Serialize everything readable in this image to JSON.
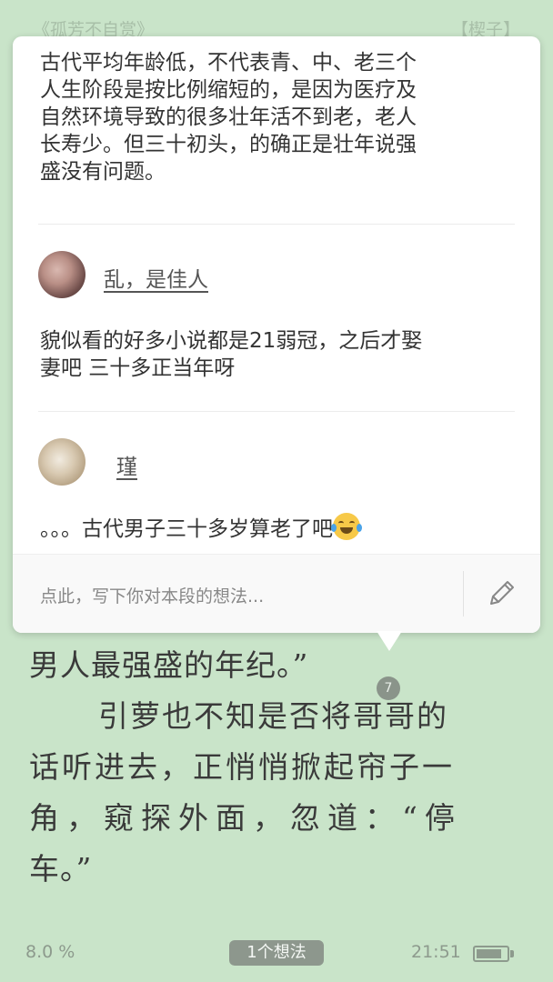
{
  "header": {
    "book_title": "《孤芳不自赏》",
    "chapter_tag": "【楔子】"
  },
  "reading": {
    "lines": [
      "男人最强盛的年纪。”",
      "引萝也不知是否将哥哥的",
      "话听进去，正悄悄掀起帘子一",
      "角，窥探外面，忽道：“停",
      "车。”"
    ],
    "idea_count_badge": "7"
  },
  "popup": {
    "comments": [
      {
        "text_lines": [
          "古代平均年龄低，不代表青、中、老三个",
          "人生阶段是按比例缩短的，是因为医疗及",
          "自然环境导致的很多壮年活不到老，老人",
          "长寿少。但三十初头，的确正是壮年说强",
          "盛没有问题。"
        ]
      },
      {
        "user": "乱，是佳人",
        "text_lines": [
          "貌似看的好多小说都是21弱冠，之后才娶",
          "妻吧  三十多正当年呀"
        ]
      },
      {
        "user": "瑾",
        "text": "。。。古代男子三十多岁算老了吧",
        "emoji": "face-with-tears-of-joy-icon"
      }
    ],
    "input_placeholder": "点此，写下你对本段的想法..."
  },
  "status_bar": {
    "progress": "8.0 %",
    "ideas_label": "1个想法",
    "time": "21:51",
    "battery_level": 0.85
  },
  "colors": {
    "background": "#c9e4c9",
    "text": "#3a3a3a",
    "muted": "#8d9a8d"
  }
}
